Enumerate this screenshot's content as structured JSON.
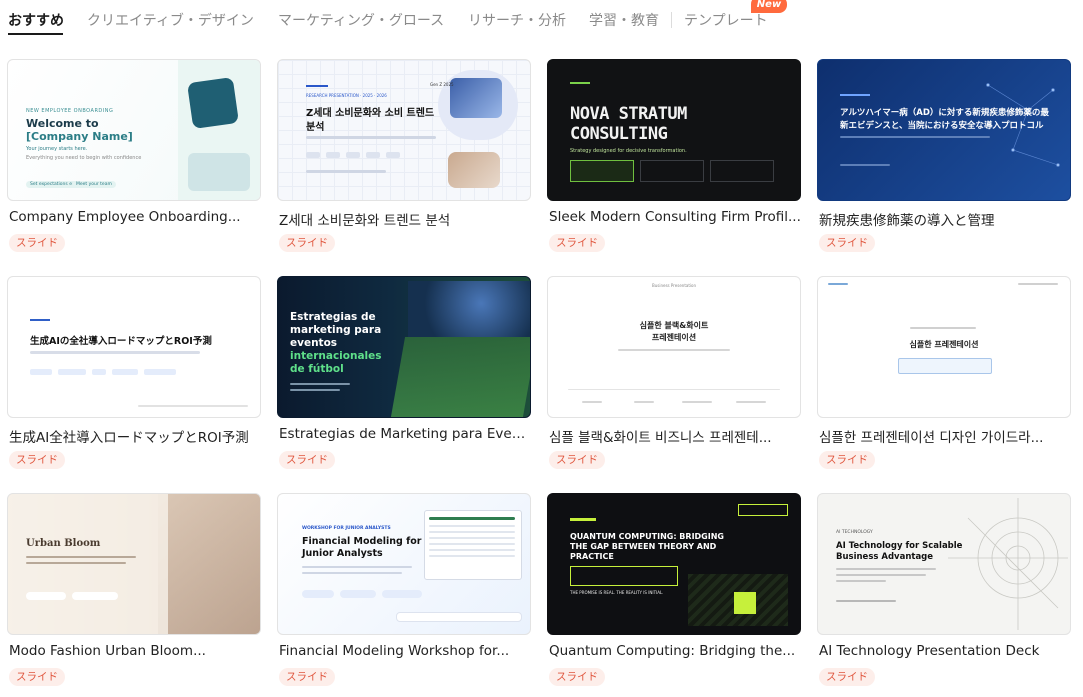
{
  "tabs": [
    {
      "label": "おすすめ",
      "active": true
    },
    {
      "label": "クリエイティブ・デザイン"
    },
    {
      "label": "マーケティング・グロース"
    },
    {
      "label": "リサーチ・分析"
    },
    {
      "label": "学習・教育"
    },
    {
      "label": "テンプレート"
    }
  ],
  "new_badge": "New",
  "tag_label": "スライド",
  "cards": [
    {
      "title": "Company Employee Onboarding...",
      "thumb": {
        "kicker": "NEW EMPLOYEE ONBOARDING",
        "heading": "Welcome to",
        "heading2": "[Company Name]",
        "sub": "Your journey starts here.",
        "sub2": "Everything you need to begin with confidence",
        "chip1": "Set expectations early",
        "chip2": "Meet your team"
      }
    },
    {
      "title": "Z세대 소비문화와 트렌드 분석",
      "thumb": {
        "kicker": "RESEARCH PRESENTATION · 2025 · 2026",
        "heading": "Z세대 소비문화와 소비 트렌드",
        "heading2": "분석",
        "corner": "Gen Z 2025"
      }
    },
    {
      "title": "Sleek Modern Consulting Firm Profil...",
      "thumb": {
        "heading": "NOVA STRATUM",
        "heading2": "CONSULTING",
        "sub": "Strategy designed for decisive transformation."
      }
    },
    {
      "title": "新規疾患修飾薬の導入と管理",
      "thumb": {
        "heading": "アルツハイマー病（AD）に対する新規疾患修飾薬の最",
        "heading2": "新エビデンスと、当院における安全な導入プロトコル"
      }
    },
    {
      "title": "生成AI全社導入ロードマップとROI予測",
      "thumb": {
        "heading": "生成AIの全社導入ロードマップとROI予測"
      }
    },
    {
      "title": "Estrategias de Marketing para Event...",
      "thumb": {
        "heading": "Estrategias de",
        "heading2": "marketing para",
        "heading3": "eventos",
        "accent": "internacionales",
        "accent2": "de fútbol"
      }
    },
    {
      "title": "심플 블랙&화이트 비즈니스 프레젠테...",
      "thumb": {
        "kicker": "Business Presentation",
        "heading": "심플한 블랙&화이트",
        "heading2": "프레젠테이션"
      }
    },
    {
      "title": "심플한 프레젠테이션 디자인 가이드라...",
      "thumb": {
        "heading": "심플한 프레젠테이션"
      }
    },
    {
      "title": "Modo Fashion Urban Bloom...",
      "thumb": {
        "heading": "Urban Bloom"
      }
    },
    {
      "title": "Financial Modeling Workshop for...",
      "thumb": {
        "kicker": "WORKSHOP FOR JUNIOR ANALYSTS",
        "heading": "Financial Modeling for",
        "heading2": "Junior Analysts"
      }
    },
    {
      "title": "Quantum Computing: Bridging the...",
      "thumb": {
        "heading": "QUANTUM COMPUTING: BRIDGING",
        "heading2": "THE GAP BETWEEN THEORY AND",
        "heading3": "PRACTICE",
        "footer": "THE PROMISE IS REAL. THE REALITY IS INITIAL."
      }
    },
    {
      "title": "AI Technology Presentation Deck",
      "thumb": {
        "kicker": "AI TECHNOLOGY",
        "heading": "AI Technology for Scalable",
        "heading2": "Business Advantage"
      }
    }
  ]
}
